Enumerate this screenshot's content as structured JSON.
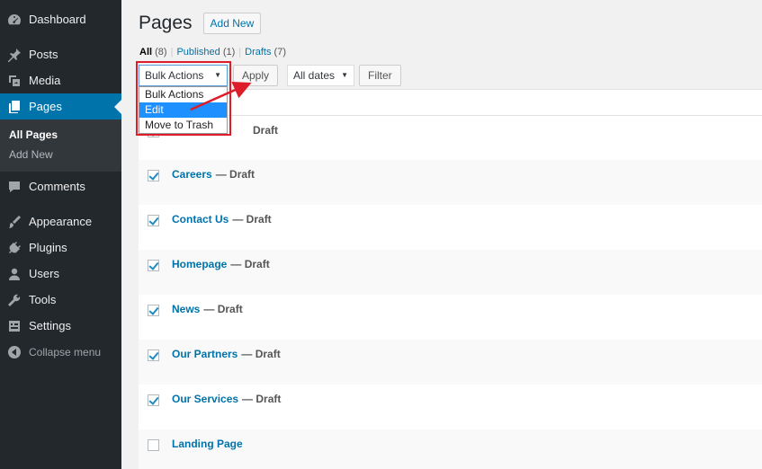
{
  "sidebar": {
    "items": [
      {
        "label": "Dashboard",
        "icon": "dashboard-icon"
      },
      {
        "label": "Posts",
        "icon": "pin-icon"
      },
      {
        "label": "Media",
        "icon": "media-icon"
      },
      {
        "label": "Pages",
        "icon": "pages-icon"
      },
      {
        "label": "Comments",
        "icon": "comments-icon"
      },
      {
        "label": "Appearance",
        "icon": "appearance-icon"
      },
      {
        "label": "Plugins",
        "icon": "plugins-icon"
      },
      {
        "label": "Users",
        "icon": "users-icon"
      },
      {
        "label": "Tools",
        "icon": "tools-icon"
      },
      {
        "label": "Settings",
        "icon": "settings-icon"
      }
    ],
    "submenu": [
      "All Pages",
      "Add New"
    ],
    "collapse_label": "Collapse menu"
  },
  "header": {
    "title": "Pages",
    "add_new": "Add New"
  },
  "filters": {
    "all": "All",
    "all_count": "(8)",
    "published": "Published",
    "published_count": "(1)",
    "drafts": "Drafts",
    "drafts_count": "(7)"
  },
  "toolbar": {
    "bulk_selected": "Bulk Actions",
    "apply": "Apply",
    "dates_selected": "All dates",
    "filter": "Filter"
  },
  "dropdown": {
    "options": [
      "Bulk Actions",
      "Edit",
      "Move to Trash"
    ],
    "highlighted": "Edit"
  },
  "rows": [
    {
      "title": "",
      "state": "Draft",
      "checked": true
    },
    {
      "title": "Careers",
      "state": "— Draft",
      "checked": true
    },
    {
      "title": "Contact Us",
      "state": "— Draft",
      "checked": true
    },
    {
      "title": "Homepage",
      "state": "— Draft",
      "checked": true
    },
    {
      "title": "News",
      "state": "— Draft",
      "checked": true
    },
    {
      "title": "Our Partners",
      "state": "— Draft",
      "checked": true
    },
    {
      "title": "Our Services",
      "state": "— Draft",
      "checked": true
    },
    {
      "title": "Landing Page",
      "state": "",
      "checked": false
    }
  ],
  "colors": {
    "sidebar_bg": "#23282d",
    "accent": "#0073aa",
    "highlight_box": "#dd1e2a"
  }
}
